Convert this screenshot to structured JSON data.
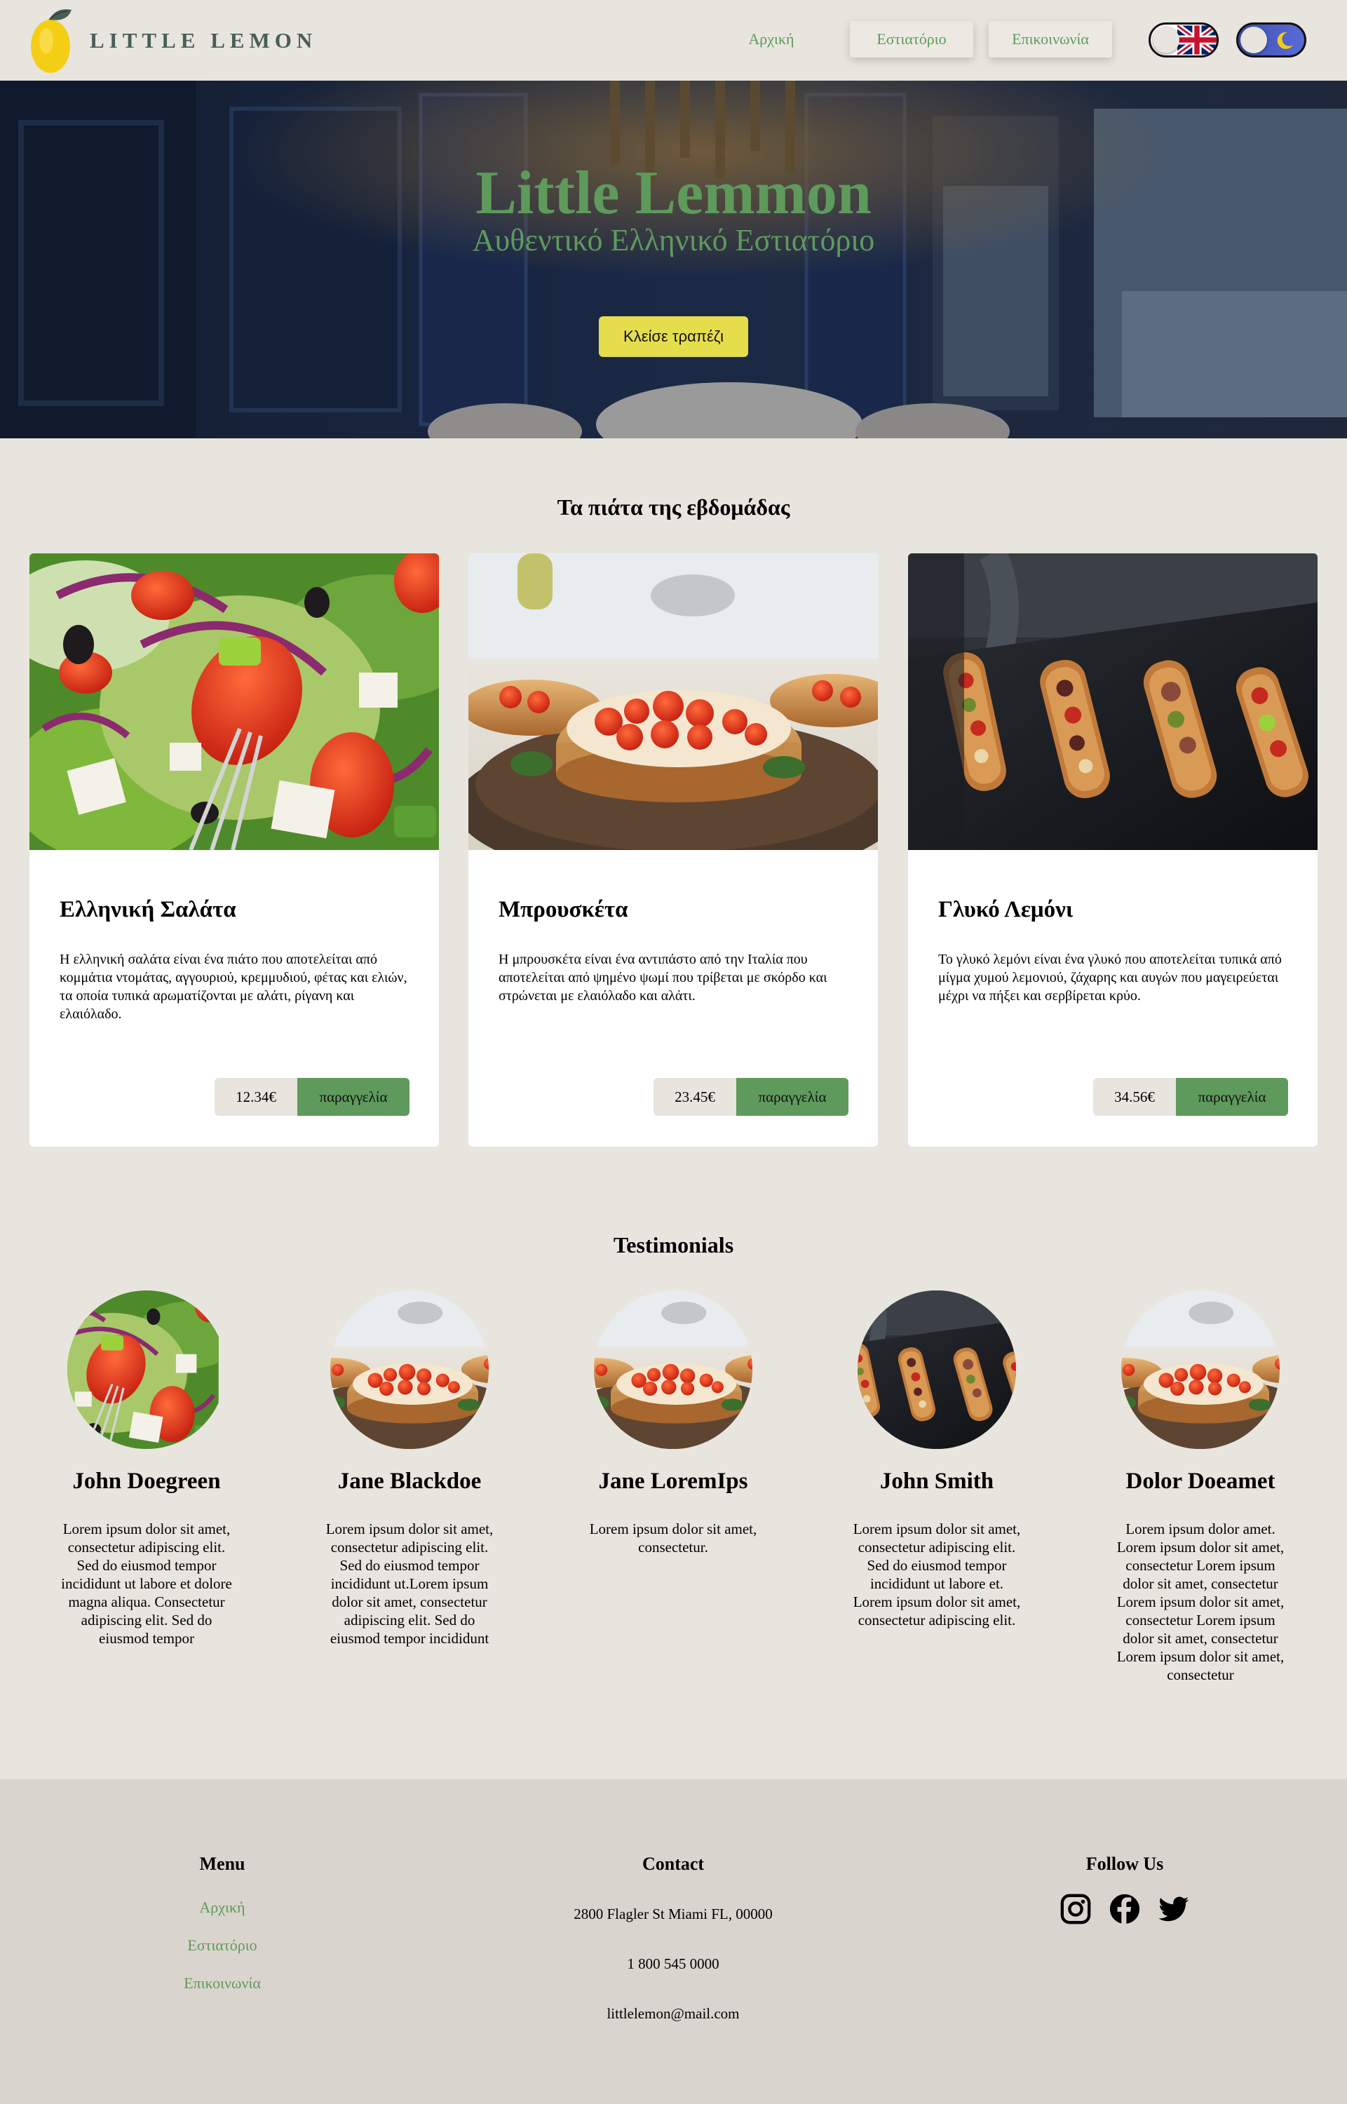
{
  "header": {
    "logo_text": "LITTLE LEMON",
    "nav": [
      "Αρχική",
      "Εστιατόριο",
      "Επικοινωνία"
    ],
    "language_toggle_icon": "uk-flag-icon",
    "theme_toggle_icon": "moon-icon"
  },
  "hero": {
    "title": "Little Lemmon",
    "subtitle": "Αυθεντικό Ελληνικό Εστιατόριο",
    "button_label": "Κλείσε τραπέζι"
  },
  "specials": {
    "title": "Τα πιάτα της εβδομάδας",
    "items": [
      {
        "title": "Ελληνική Σαλάτα",
        "description": "Η ελληνική σαλάτα είναι ένα πιάτο που αποτελείται από κομμάτια ντομάτας, αγγουριού, κρεμμυδιού, φέτας και ελιών, τα οποία τυπικά αρωματίζονται με αλάτι, ρίγανη και ελαιόλαδο.",
        "price": "12.34€",
        "order_label": "παραγγελία"
      },
      {
        "title": "Μπρουσκέτα",
        "description": "Η μπρουσκέτα είναι ένα αντιπάστο από την Ιταλία που αποτελείται από ψημένο ψωμί που τρίβεται με σκόρδο και στρώνεται με ελαιόλαδο και αλάτι.",
        "price": "23.45€",
        "order_label": "παραγγελία"
      },
      {
        "title": "Γλυκό Λεμόνι",
        "description": "Το γλυκό λεμόνι είναι ένα γλυκό που αποτελείται τυπικά από μίγμα χυμού λεμονιού, ζάχαρης και αυγών που μαγειρεύεται μέχρι να πήξει και σερβίρεται κρύο.",
        "price": "34.56€",
        "order_label": "παραγγελία"
      }
    ]
  },
  "testimonials": {
    "title": "Testimonials",
    "items": [
      {
        "name": "John Doegreen",
        "text": "Lorem ipsum dolor sit amet, consectetur adipiscing elit. Sed do eiusmod tempor incididunt ut labore et dolore magna aliqua. Consectetur adipiscing elit. Sed do eiusmod tempor"
      },
      {
        "name": "Jane Blackdoe",
        "text": "Lorem ipsum dolor sit amet, consectetur adipiscing elit. Sed do eiusmod tempor incididunt ut.Lorem ipsum dolor sit amet, consectetur adipiscing elit. Sed do eiusmod tempor incididunt"
      },
      {
        "name": "Jane LoremIps",
        "text": "Lorem ipsum dolor sit amet, consectetur."
      },
      {
        "name": "John Smith",
        "text": "Lorem ipsum dolor sit amet, consectetur adipiscing elit. Sed do eiusmod tempor incididunt ut labore et. Lorem ipsum dolor sit amet, consectetur adipiscing elit."
      },
      {
        "name": "Dolor Doeamet",
        "text": "Lorem ipsum dolor amet. Lorem ipsum dolor sit amet, consectetur Lorem ipsum dolor sit amet, consectetur Lorem ipsum dolor sit amet, consectetur Lorem ipsum dolor sit amet, consectetur Lorem ipsum dolor sit amet, consectetur"
      }
    ]
  },
  "footer": {
    "menu_title": "Menu",
    "menu_links": [
      "Αρχική",
      "Εστιατόριο",
      "Επικοινωνία"
    ],
    "contact_title": "Contact",
    "address": "2800 Flagler St Miami FL, 00000",
    "phone": "1 800 545 0000",
    "email": "littlelemon@mail.com",
    "follow_title": "Follow Us",
    "social_icons": [
      "instagram-icon",
      "facebook-icon",
      "twitter-icon"
    ]
  },
  "colors": {
    "background": "#e8e5de",
    "accent_green": "#5e9a5c",
    "dark_green": "#495e57",
    "yellow": "#e6dd4c",
    "footer_bg": "#d9d4cd"
  }
}
